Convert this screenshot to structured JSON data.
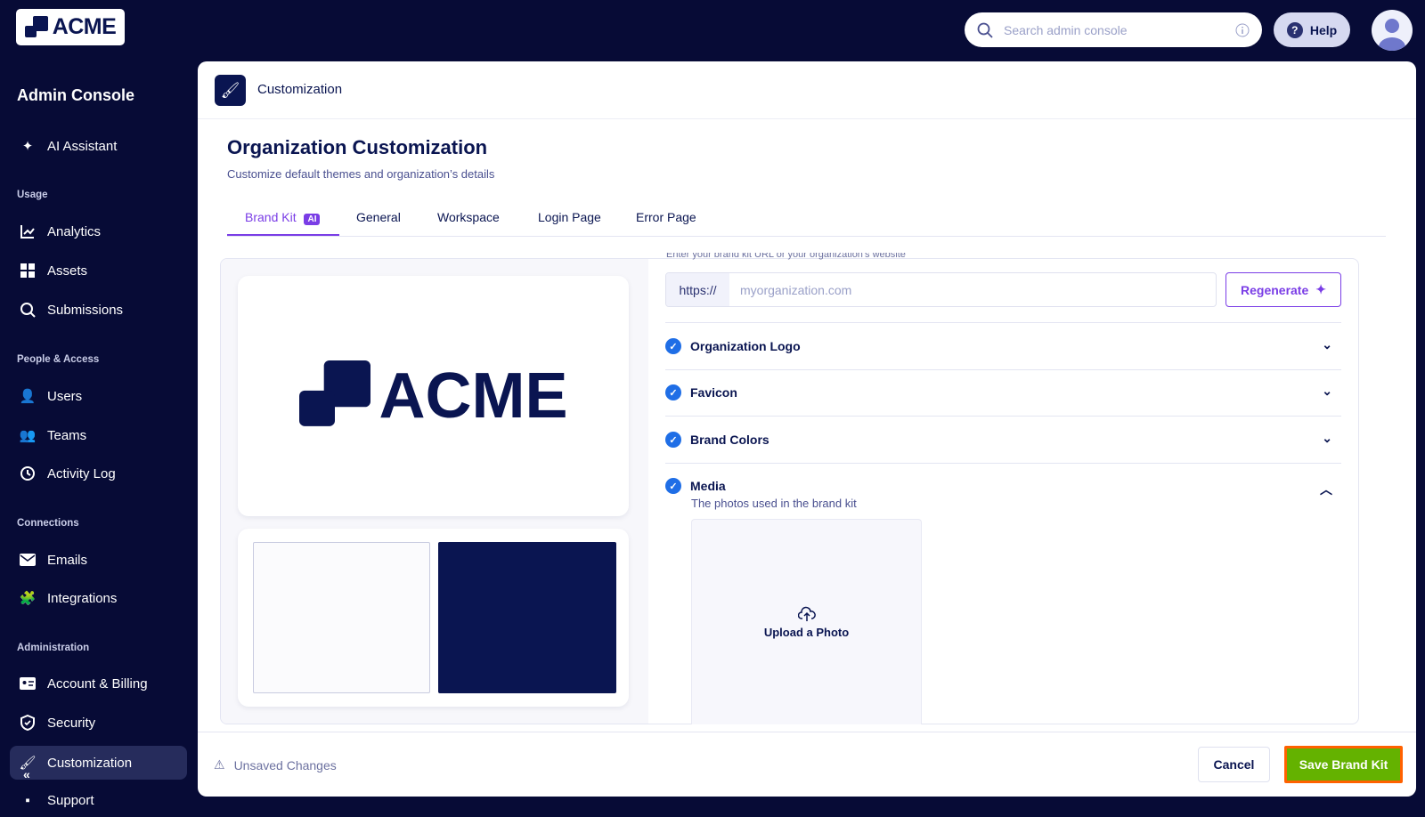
{
  "brand": {
    "logo_text": "ACME"
  },
  "sidebar": {
    "title": "Admin Console",
    "ai": "AI Assistant",
    "sections": {
      "usage": "Usage",
      "people": "People & Access",
      "connections": "Connections",
      "admin": "Administration"
    },
    "items": {
      "analytics": "Analytics",
      "assets": "Assets",
      "submissions": "Submissions",
      "users": "Users",
      "teams": "Teams",
      "activity": "Activity Log",
      "emails": "Emails",
      "integrations": "Integrations",
      "billing": "Account & Billing",
      "security": "Security",
      "customization": "Customization",
      "support": "Support"
    }
  },
  "topbar": {
    "search_placeholder": "Search admin console",
    "help": "Help"
  },
  "header": {
    "title": "Customization"
  },
  "page": {
    "title": "Organization Customization",
    "subtitle": "Customize default themes and organization’s details",
    "tabs": [
      "Brand Kit",
      "General",
      "Workspace",
      "Login Page",
      "Error Page"
    ],
    "ai_badge": "AI"
  },
  "brandkit": {
    "helper": "Enter your brand kit URL or your organization's website",
    "prefix": "https://",
    "url_placeholder": "myorganization.com",
    "regenerate": "Regenerate",
    "sections": [
      {
        "label": "Organization Logo"
      },
      {
        "label": "Favicon"
      },
      {
        "label": "Brand Colors"
      },
      {
        "label": "Media",
        "desc": "The photos used in the brand kit"
      }
    ],
    "upload": "Upload a Photo",
    "colors": [
      "#fbfbfd",
      "#0a1551"
    ]
  },
  "footer": {
    "unsaved": "Unsaved Changes",
    "cancel": "Cancel",
    "save": "Save Brand Kit"
  },
  "colors": {
    "nav_bg": "#070b36",
    "accent": "#7a3de6",
    "save": "#64b200",
    "save_border": "#ff6100",
    "check": "#1f6ee6"
  }
}
